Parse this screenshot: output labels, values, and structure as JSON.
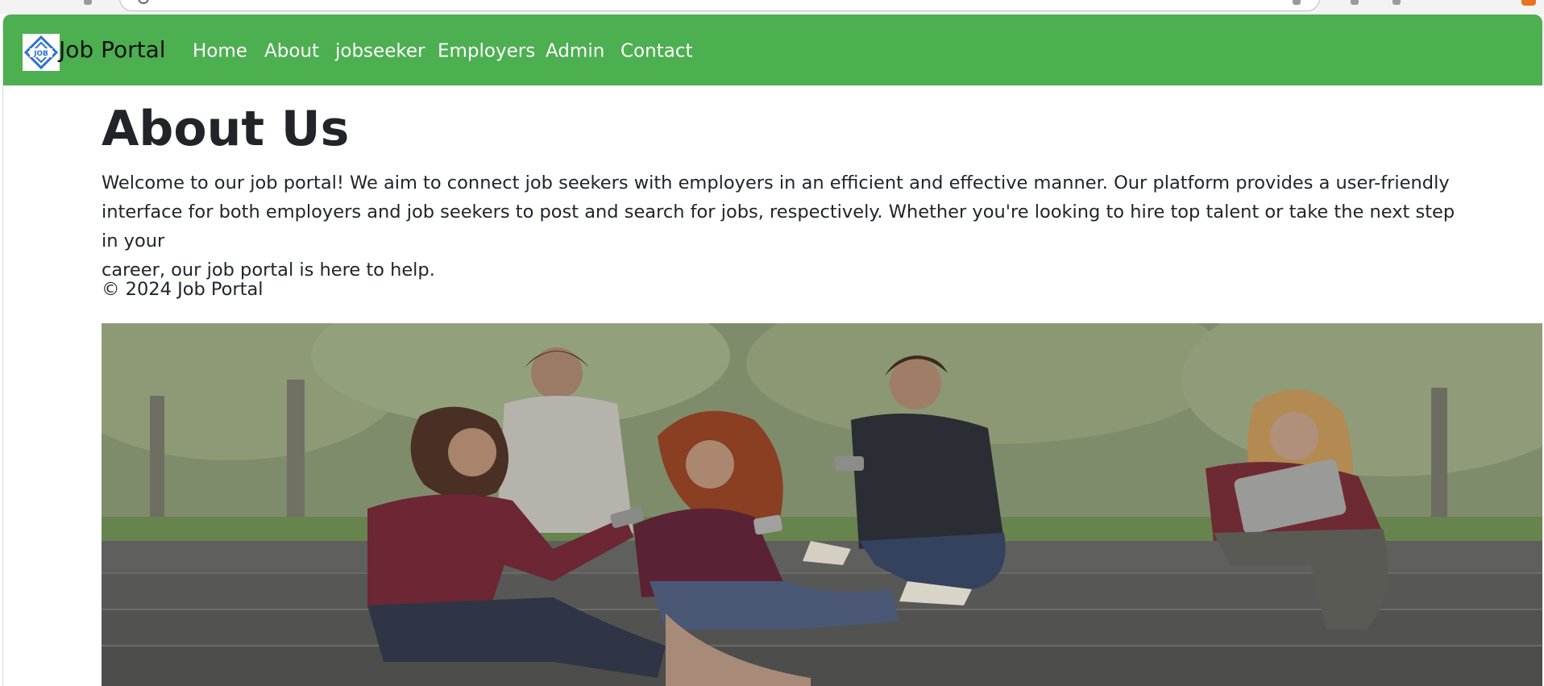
{
  "brand": {
    "name": "Job Portal",
    "logo_text": "JOB",
    "logo_icon": "diamond-logo-icon"
  },
  "nav": {
    "items": [
      {
        "label": "Home"
      },
      {
        "label": "About"
      },
      {
        "label": "jobseeker"
      },
      {
        "label": "Employers"
      },
      {
        "label": "Admin"
      },
      {
        "label": "Contact"
      }
    ]
  },
  "about": {
    "heading": "About Us",
    "lines": [
      "Welcome to our job portal! We aim to connect job seekers with employers in an efficient and effective manner. Our platform provides a user-friendly",
      "interface for both employers and job seekers to post and search for jobs, respectively. Whether you're looking to hire top talent or take the next step in your",
      "career, our job portal is here to help."
    ]
  },
  "footer": {
    "copyright": "© 2024 Job Portal"
  },
  "colors": {
    "navbar_bg": "#4caf50",
    "nav_text": "#ffffff",
    "brand_text": "#111111",
    "body_text": "#212529",
    "logo_blue": "#2f6fd6"
  }
}
